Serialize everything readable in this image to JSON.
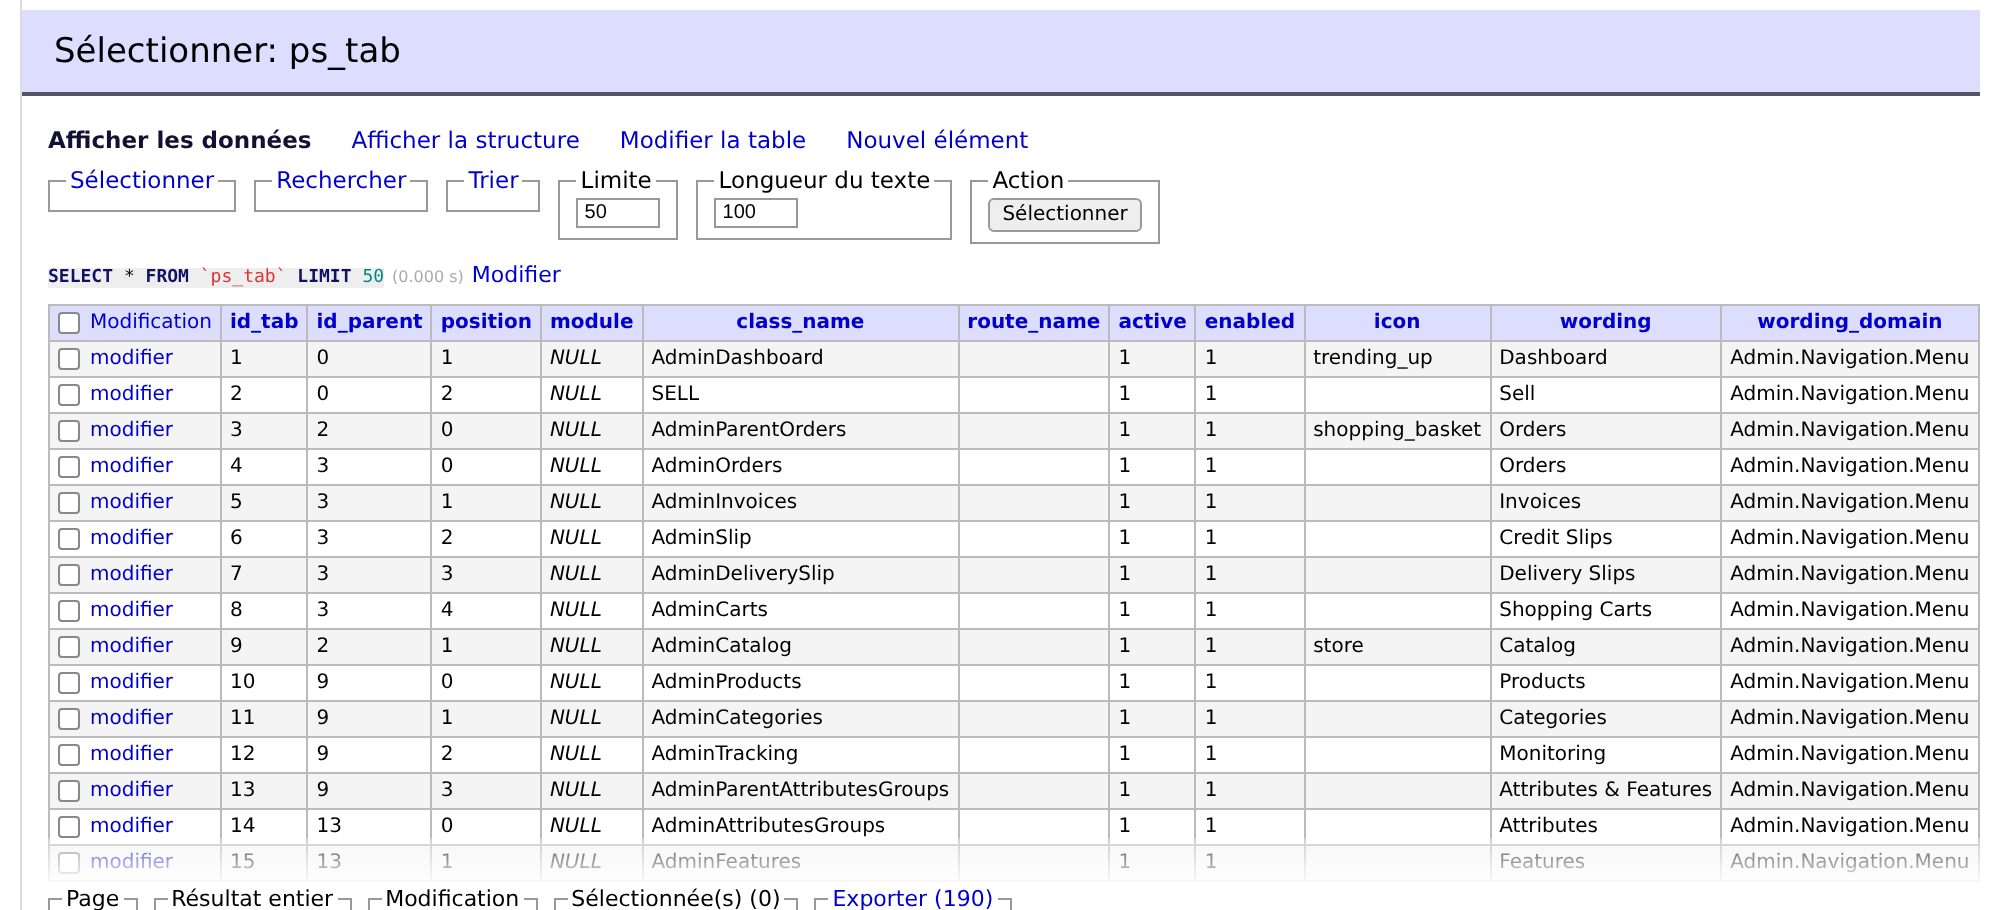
{
  "title": "Sélectionner: ps_tab",
  "links": [
    {
      "label": "Afficher les données",
      "selected": true
    },
    {
      "label": "Afficher la structure",
      "selected": false
    },
    {
      "label": "Modifier la table",
      "selected": false
    },
    {
      "label": "Nouvel élément",
      "selected": false
    }
  ],
  "fieldsets": [
    {
      "legend": "Sélectionner",
      "kind": "link"
    },
    {
      "legend": "Rechercher",
      "kind": "link"
    },
    {
      "legend": "Trier",
      "kind": "link"
    },
    {
      "legend": "Limite",
      "kind": "input",
      "value": "50"
    },
    {
      "legend": "Longueur du texte",
      "kind": "input",
      "value": "100"
    },
    {
      "legend": "Action",
      "kind": "button",
      "button": "Sélectionner"
    }
  ],
  "query": {
    "parts": [
      {
        "text": "SELECT",
        "kind": "keyword"
      },
      {
        "text": "*",
        "kind": "plain"
      },
      {
        "text": "FROM",
        "kind": "keyword"
      },
      {
        "text": "`ps_tab`",
        "kind": "identifier"
      },
      {
        "text": "LIMIT",
        "kind": "keyword"
      },
      {
        "text": "50",
        "kind": "number"
      }
    ],
    "time": "(0.000 s)",
    "edit": "Modifier"
  },
  "table": {
    "select_all": {
      "label": "Modification",
      "checked": false
    },
    "columns": [
      "id_tab",
      "id_parent",
      "position",
      "module",
      "class_name",
      "route_name",
      "active",
      "enabled",
      "icon",
      "wording",
      "wording_domain"
    ],
    "rows": [
      {
        "checked": false,
        "action": "modifier",
        "cells": [
          "1",
          "0",
          "1",
          "NULL",
          "AdminDashboard",
          "",
          "1",
          "1",
          "trending_up",
          "Dashboard",
          "Admin.Navigation.Menu"
        ]
      },
      {
        "checked": false,
        "action": "modifier",
        "cells": [
          "2",
          "0",
          "2",
          "NULL",
          "SELL",
          "",
          "1",
          "1",
          "",
          "Sell",
          "Admin.Navigation.Menu"
        ]
      },
      {
        "checked": false,
        "action": "modifier",
        "cells": [
          "3",
          "2",
          "0",
          "NULL",
          "AdminParentOrders",
          "",
          "1",
          "1",
          "shopping_basket",
          "Orders",
          "Admin.Navigation.Menu"
        ]
      },
      {
        "checked": false,
        "action": "modifier",
        "cells": [
          "4",
          "3",
          "0",
          "NULL",
          "AdminOrders",
          "",
          "1",
          "1",
          "",
          "Orders",
          "Admin.Navigation.Menu"
        ]
      },
      {
        "checked": false,
        "action": "modifier",
        "cells": [
          "5",
          "3",
          "1",
          "NULL",
          "AdminInvoices",
          "",
          "1",
          "1",
          "",
          "Invoices",
          "Admin.Navigation.Menu"
        ]
      },
      {
        "checked": false,
        "action": "modifier",
        "cells": [
          "6",
          "3",
          "2",
          "NULL",
          "AdminSlip",
          "",
          "1",
          "1",
          "",
          "Credit Slips",
          "Admin.Navigation.Menu"
        ]
      },
      {
        "checked": false,
        "action": "modifier",
        "cells": [
          "7",
          "3",
          "3",
          "NULL",
          "AdminDeliverySlip",
          "",
          "1",
          "1",
          "",
          "Delivery Slips",
          "Admin.Navigation.Menu"
        ]
      },
      {
        "checked": false,
        "action": "modifier",
        "cells": [
          "8",
          "3",
          "4",
          "NULL",
          "AdminCarts",
          "",
          "1",
          "1",
          "",
          "Shopping Carts",
          "Admin.Navigation.Menu"
        ]
      },
      {
        "checked": false,
        "action": "modifier",
        "cells": [
          "9",
          "2",
          "1",
          "NULL",
          "AdminCatalog",
          "",
          "1",
          "1",
          "store",
          "Catalog",
          "Admin.Navigation.Menu"
        ]
      },
      {
        "checked": false,
        "action": "modifier",
        "cells": [
          "10",
          "9",
          "0",
          "NULL",
          "AdminProducts",
          "",
          "1",
          "1",
          "",
          "Products",
          "Admin.Navigation.Menu"
        ]
      },
      {
        "checked": false,
        "action": "modifier",
        "cells": [
          "11",
          "9",
          "1",
          "NULL",
          "AdminCategories",
          "",
          "1",
          "1",
          "",
          "Categories",
          "Admin.Navigation.Menu"
        ]
      },
      {
        "checked": false,
        "action": "modifier",
        "cells": [
          "12",
          "9",
          "2",
          "NULL",
          "AdminTracking",
          "",
          "1",
          "1",
          "",
          "Monitoring",
          "Admin.Navigation.Menu"
        ]
      },
      {
        "checked": false,
        "action": "modifier",
        "cells": [
          "13",
          "9",
          "3",
          "NULL",
          "AdminParentAttributesGroups",
          "",
          "1",
          "1",
          "",
          "Attributes & Features",
          "Admin.Navigation.Menu"
        ]
      },
      {
        "checked": false,
        "action": "modifier",
        "cells": [
          "14",
          "13",
          "0",
          "NULL",
          "AdminAttributesGroups",
          "",
          "1",
          "1",
          "",
          "Attributes",
          "Admin.Navigation.Menu"
        ]
      },
      {
        "checked": false,
        "action": "modifier",
        "cells": [
          "15",
          "13",
          "1",
          "NULL",
          "AdminFeatures",
          "",
          "1",
          "1",
          "",
          "Features",
          "Admin.Navigation.Menu"
        ]
      }
    ]
  },
  "footer": [
    {
      "legend": "Page",
      "kind": "plain"
    },
    {
      "legend": "Résultat entier",
      "kind": "plain"
    },
    {
      "legend": "Modification",
      "kind": "plain"
    },
    {
      "legend": "Sélectionnée(s) (0)",
      "kind": "plain"
    },
    {
      "legend": "Exporter (190)",
      "kind": "link"
    }
  ]
}
